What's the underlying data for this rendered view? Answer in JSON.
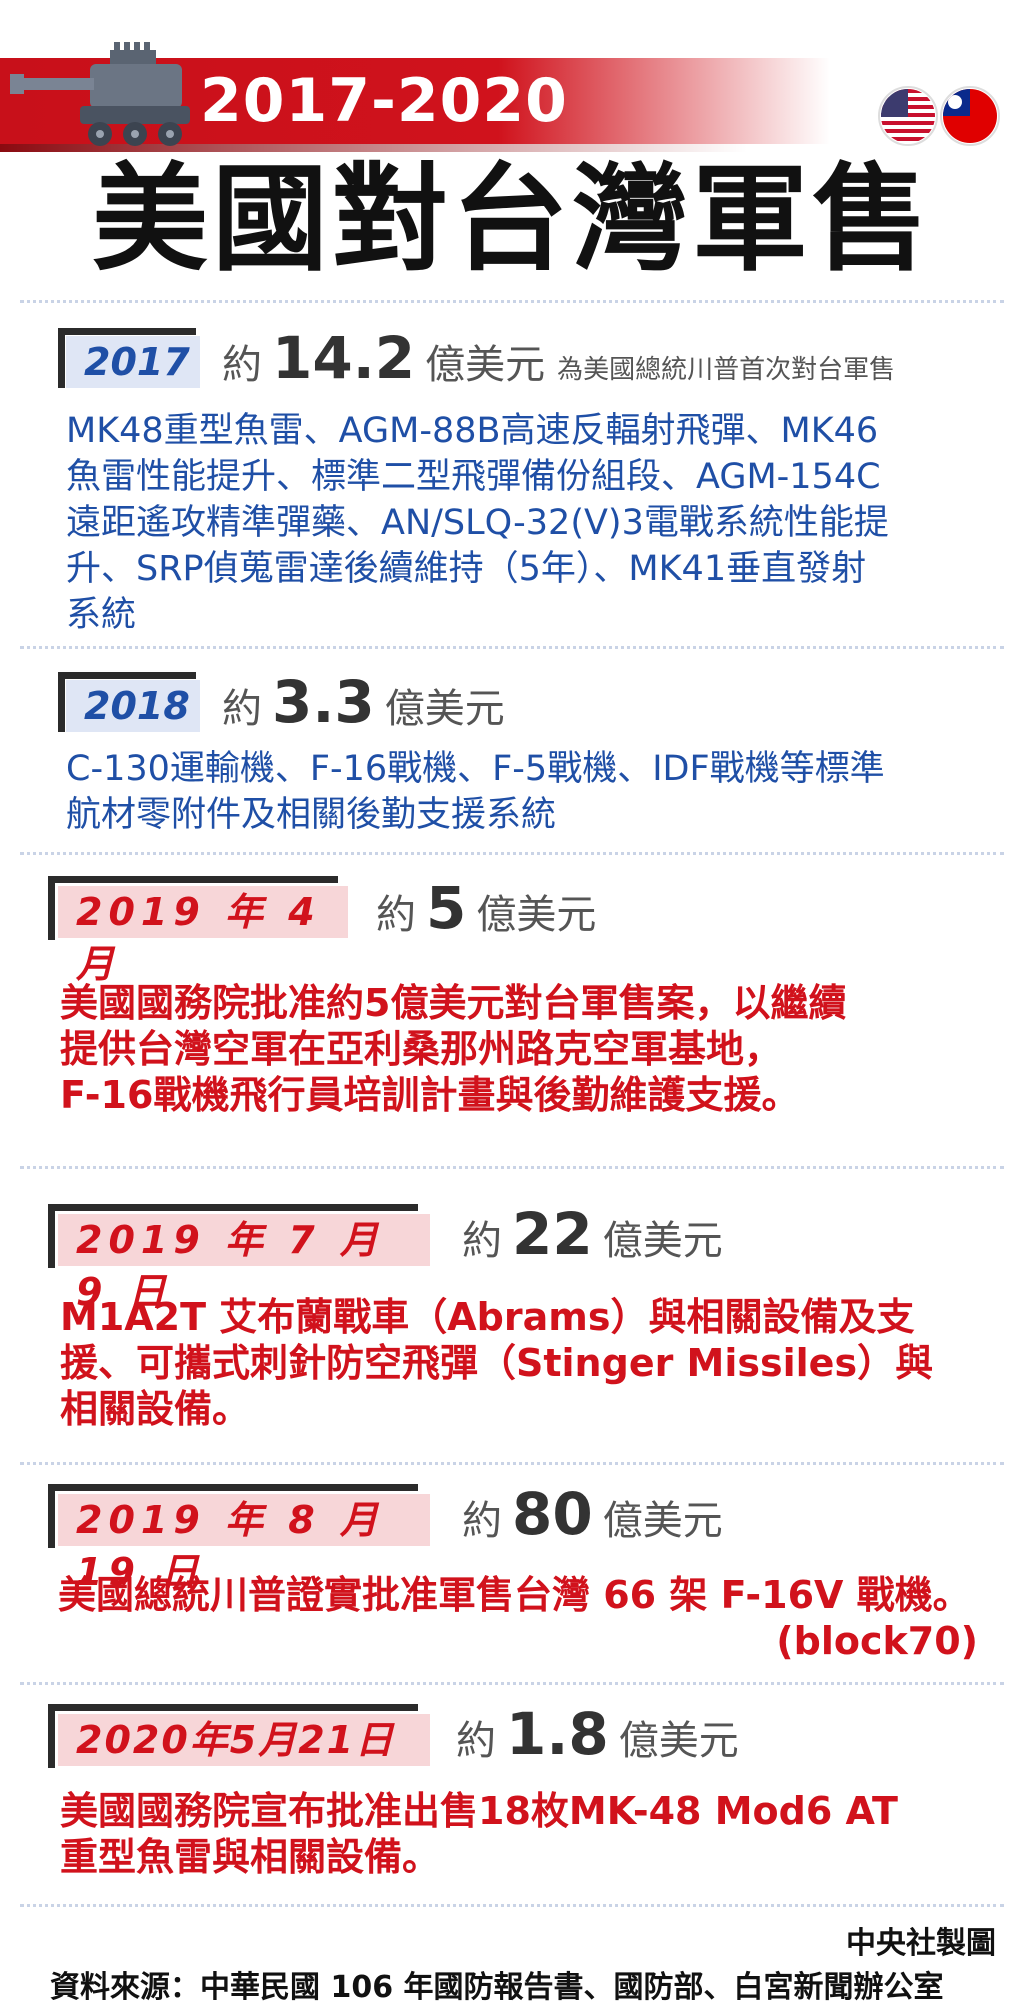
{
  "header": {
    "year_range": "2017-2020",
    "title": "美國對台灣軍售",
    "flag_icons": [
      "us-flag-icon",
      "roc-flag-icon"
    ],
    "colors": {
      "banner_red": "#c8101a",
      "text_blue": "#1f4fa6",
      "text_red": "#d1121c"
    }
  },
  "entries": [
    {
      "date": "2017",
      "prefix": "約",
      "amount": "14.2",
      "unit": "億美元",
      "note": "為美國總統川普首次對台軍售",
      "lines": [
        "MK48重型魚雷、AGM-88B高速反輻射飛彈、MK46",
        "魚雷性能提升、標準二型飛彈備份組段、AGM-154C",
        "遠距遙攻精準彈藥、AN/SLQ-32(V)3電戰系統性能提",
        "升、SRP偵蒐雷達後續維持（5年）、MK41垂直發射",
        "系統"
      ]
    },
    {
      "date": "2018",
      "prefix": "約",
      "amount": "3.3",
      "unit": "億美元",
      "lines": [
        "C-130運輸機、F-16戰機、F-5戰機、IDF戰機等標準",
        "航材零附件及相關後勤支援系統"
      ]
    },
    {
      "date": "2019 年 4 月",
      "prefix": "約",
      "amount": "5",
      "unit": "億美元",
      "lines": [
        "美國國務院批准約5億美元對台軍售案，以繼續",
        "提供台灣空軍在亞利桑那州路克空軍基地，",
        "F-16戰機飛行員培訓計畫與後勤維護支援。"
      ]
    },
    {
      "date": "2019 年 7 月 9 日",
      "prefix": "約",
      "amount": "22",
      "unit": "億美元",
      "lines": [
        "M1A2T 艾布蘭戰車（Abrams）與相關設備及支",
        "援、可攜式刺針防空飛彈（Stinger Missiles）與",
        "相關設備。"
      ]
    },
    {
      "date": "2019 年 8 月 19 日",
      "prefix": "約",
      "amount": "80",
      "unit": "億美元",
      "lines": [
        "美國總統川普證實批准軍售台灣 66 架 F-16V 戰機。",
        "(block70)"
      ]
    },
    {
      "date": "2020年5月21日",
      "prefix": "約",
      "amount": "1.8",
      "unit": "億美元",
      "lines": [
        "美國國務院宣布批准出售18枚MK-48 Mod6 AT",
        "重型魚雷與相關設備。"
      ]
    }
  ],
  "footer": {
    "credit": "中央社製圖",
    "source": "資料來源：中華民國 106 年國防報告書、國防部、白宮新聞辦公室"
  }
}
